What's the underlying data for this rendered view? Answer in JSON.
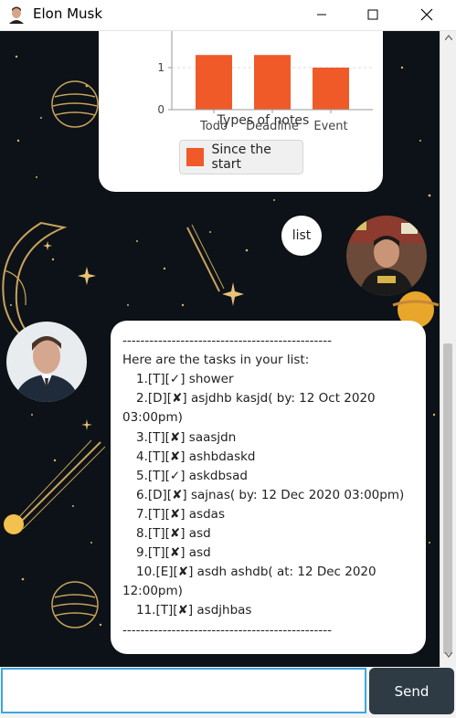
{
  "window": {
    "title": "Elon Musk",
    "icon": "elon-portrait-icon",
    "controls": [
      "minimize-icon",
      "maximize-icon",
      "close-icon"
    ]
  },
  "chart_data": {
    "type": "bar",
    "categories": [
      "Todo",
      "Deadline",
      "Event"
    ],
    "series": [
      {
        "name": "Since the start",
        "values": [
          1.3,
          1.3,
          1.0
        ]
      }
    ],
    "xlabel": "Types of notes",
    "ylabel": "",
    "yticks": [
      "0",
      "1"
    ],
    "legend": "bottom",
    "grid": true,
    "bar_color": "#f05a28"
  },
  "conversation": {
    "user_message": "list",
    "bot_message_lines": [
      "-----------------------------------------------",
      "Here are the tasks in your list:",
      "1.[T][✓] shower",
      "2.[D][✘] asjdhb kasjd( by: 12 Oct 2020",
      "03:00pm)",
      "3.[T][✘] saasjdn",
      "4.[T][✘] ashbdaskd",
      "5.[T][✓] askdbsad",
      "6.[D][✘] sajnas( by: 12 Dec 2020 03:00pm)",
      "7.[T][✘] asdas",
      "8.[T][✘] asd",
      "9.[T][✘] asd",
      "10.[E][✘] asdh ashdb( at: 12 Dec 2020",
      "12:00pm)",
      "11.[T][✘] asdjhbas",
      "-----------------------------------------------"
    ]
  },
  "input": {
    "value": "",
    "placeholder": "",
    "send_label": "Send"
  },
  "colors": {
    "chat_background": "#0c1217",
    "accent": "#3ea6dc",
    "send_button": "#2f3b44"
  }
}
